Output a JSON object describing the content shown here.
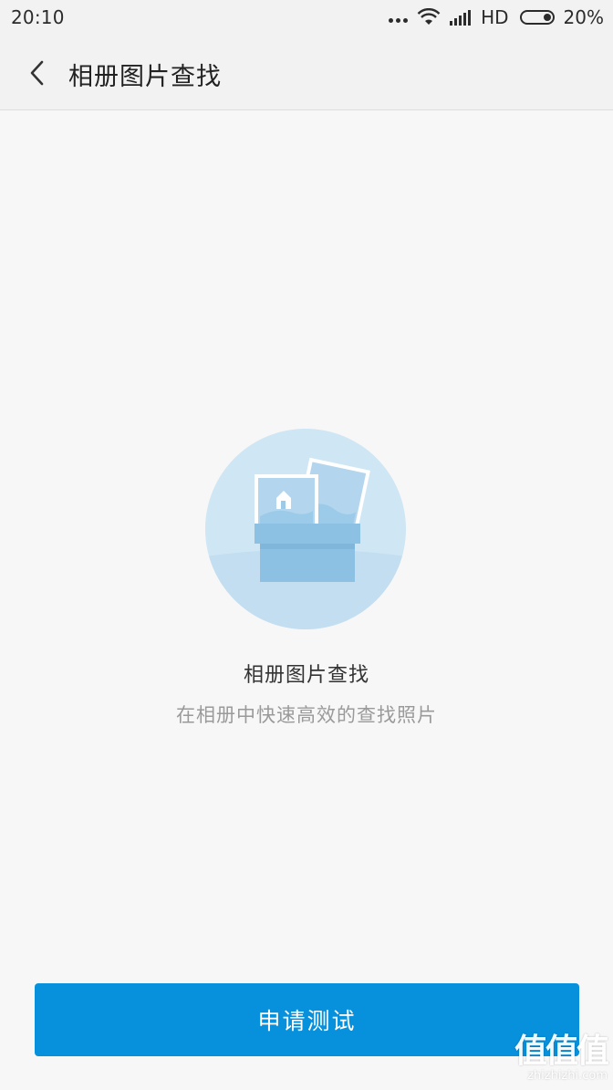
{
  "status_bar": {
    "time": "20:10",
    "network": "HD",
    "battery": "20%",
    "battery_level": 0.2
  },
  "header": {
    "title": "相册图片查找",
    "back_icon": "chevron-left-icon"
  },
  "feature": {
    "illustration_icon": "photo-album-box-icon",
    "title": "相册图片查找",
    "description": "在相册中快速高效的查找照片"
  },
  "actions": {
    "apply_label": "申请测试"
  },
  "watermark": {
    "logo_text": "值值值",
    "site": "zhizhizhi.com"
  },
  "colors": {
    "accent": "#0790dc",
    "illustration_circle": "#cfe6f4",
    "illustration_box": "#8cc1e3"
  }
}
